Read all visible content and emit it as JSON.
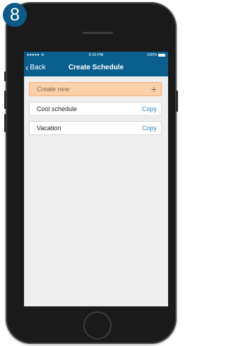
{
  "step_badge": "8",
  "status_bar": {
    "signal": "●●●●● ≋",
    "time": "6:10 PM",
    "battery": "100%"
  },
  "nav": {
    "back_label": "Back",
    "title": "Create Schedule"
  },
  "create_new": {
    "label": "Create new",
    "icon": "+"
  },
  "schedules": [
    {
      "name": "Cool schedule",
      "action": "Copy"
    },
    {
      "name": "Vacation",
      "action": "Copy"
    }
  ],
  "colors": {
    "accent": "#0a5f8f",
    "highlight": "#fbd0a8",
    "link": "#2a84c8"
  }
}
